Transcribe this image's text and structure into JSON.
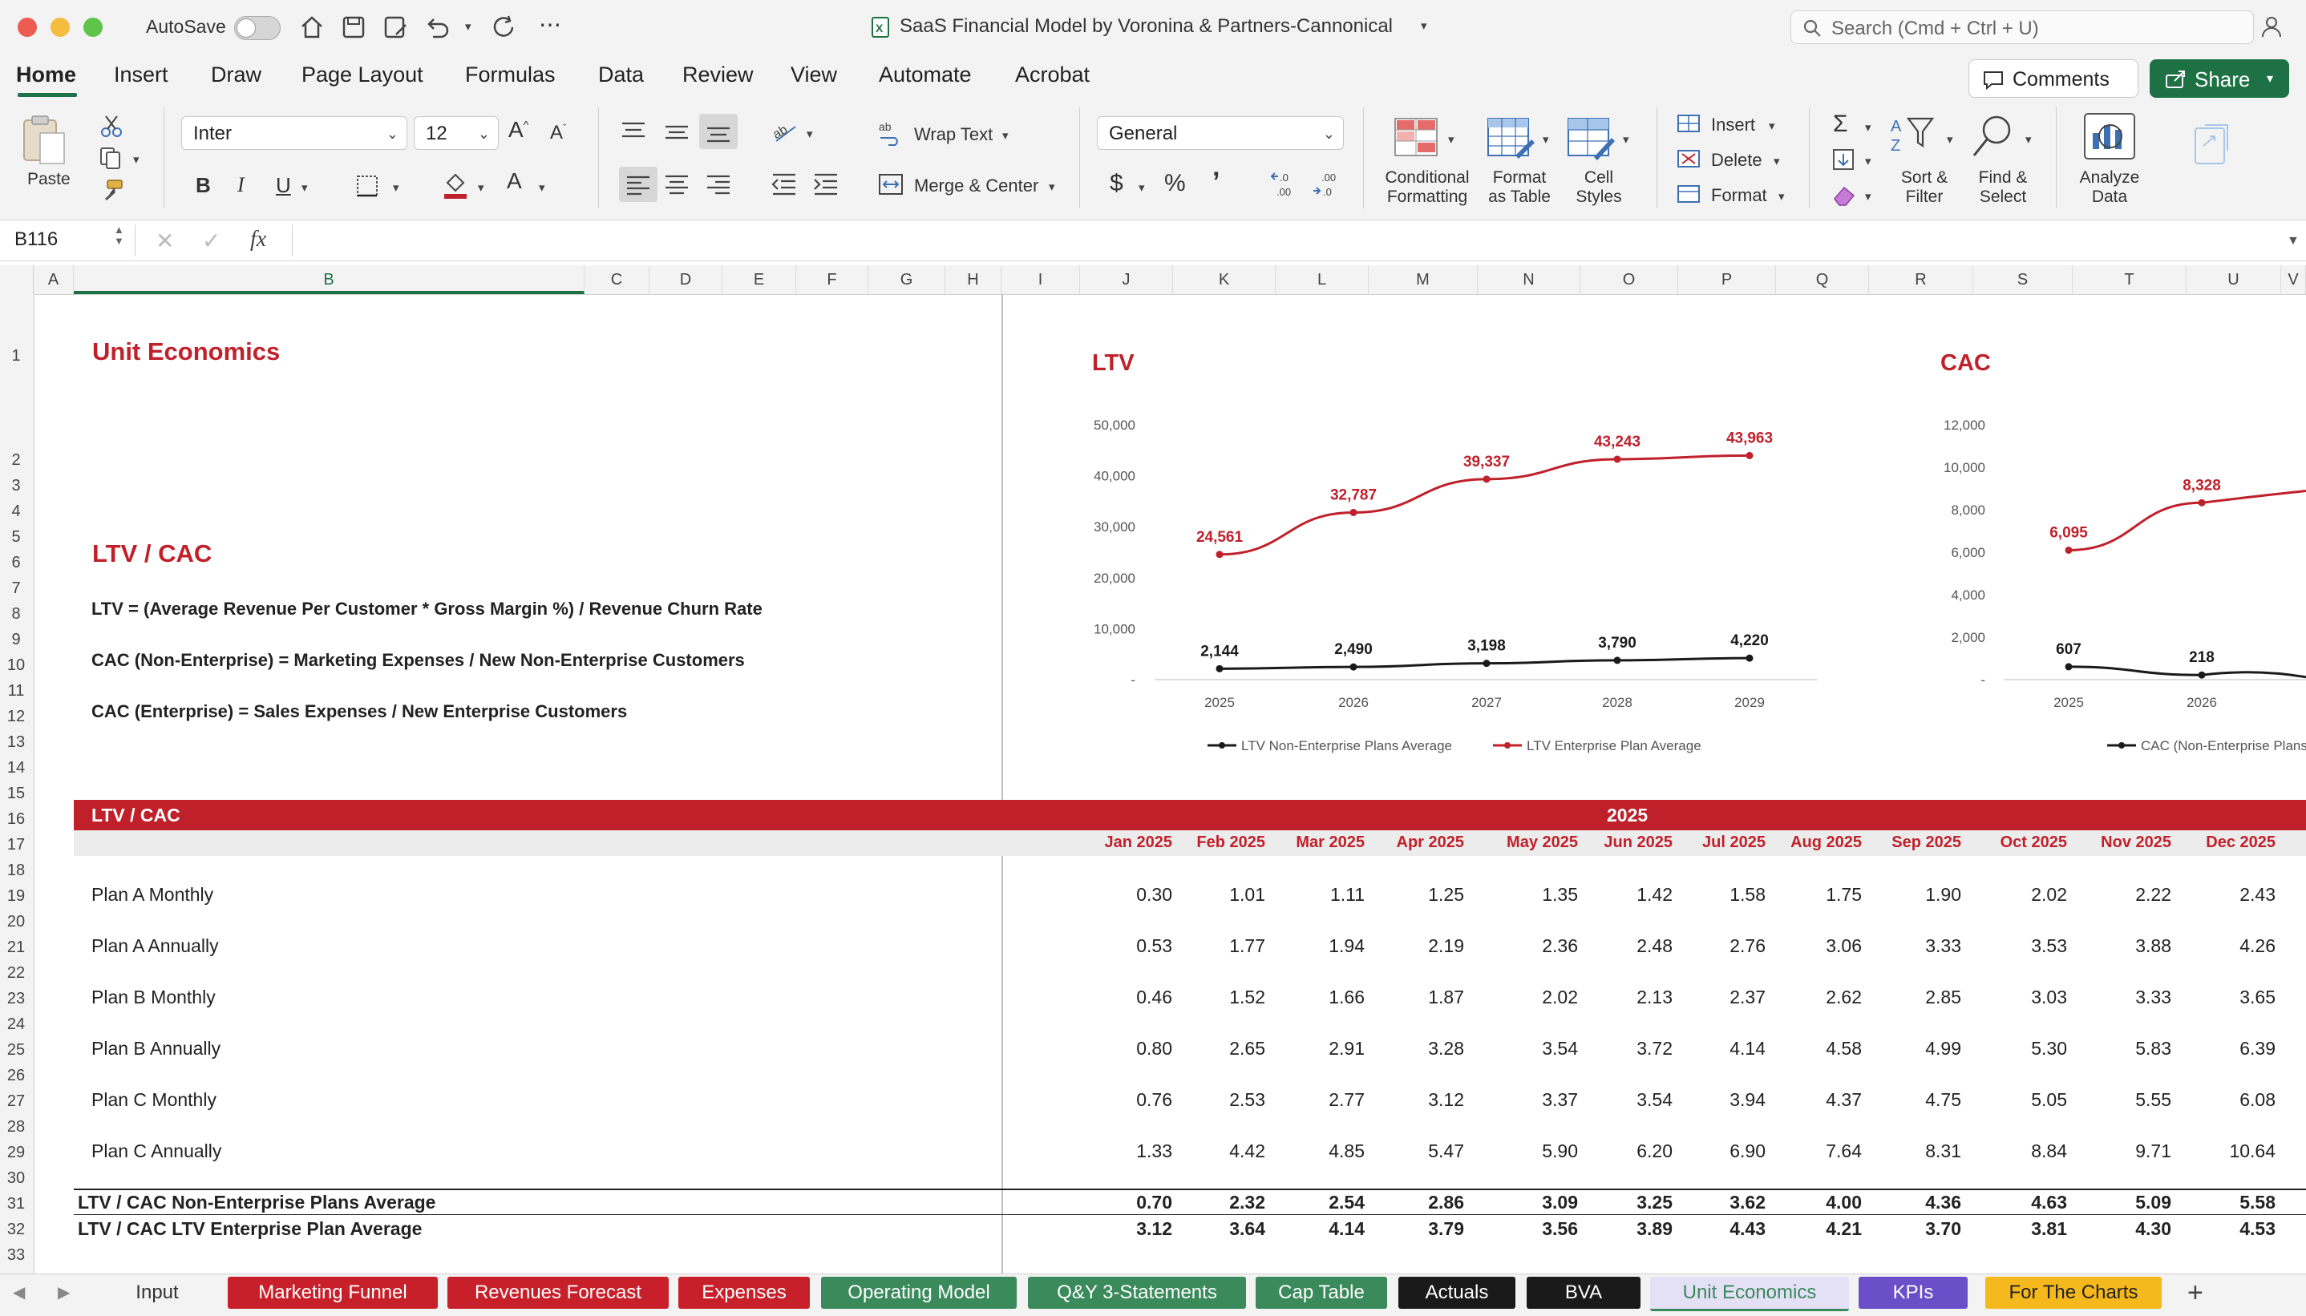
{
  "window": {
    "autosave_label": "AutoSave",
    "title": "SaaS Financial Model by Voronina & Partners-Cannonical",
    "search_placeholder": "Search (Cmd + Ctrl + U)"
  },
  "ribbon_tabs": [
    "Home",
    "Insert",
    "Draw",
    "Page Layout",
    "Formulas",
    "Data",
    "Review",
    "View",
    "Automate",
    "Acrobat"
  ],
  "buttons": {
    "comments": "Comments",
    "share": "Share"
  },
  "ribbon": {
    "paste": "Paste",
    "font_name": "Inter",
    "font_size": "12",
    "wrap_text": "Wrap Text",
    "merge_center": "Merge & Center",
    "number_format": "General",
    "conditional_formatting": [
      "Conditional",
      "Formatting"
    ],
    "format_as_table": [
      "Format",
      "as Table"
    ],
    "cell_styles": [
      "Cell",
      "Styles"
    ],
    "insert": "Insert",
    "delete": "Delete",
    "format": "Format",
    "sort_filter": [
      "Sort &",
      "Filter"
    ],
    "find_select": [
      "Find &",
      "Select"
    ],
    "analyze_data": [
      "Analyze",
      "Data"
    ]
  },
  "formula_bar": {
    "cell_ref": "B116",
    "fx": "fx",
    "value": ""
  },
  "columns": [
    "A",
    "B",
    "C",
    "D",
    "E",
    "F",
    "G",
    "H",
    "I",
    "J",
    "K",
    "L",
    "M",
    "N",
    "O",
    "P",
    "Q",
    "R",
    "S",
    "T",
    "U",
    "V"
  ],
  "rows": [
    "1",
    "2",
    "3",
    "4",
    "5",
    "6",
    "7",
    "8",
    "9",
    "10",
    "11",
    "12",
    "13",
    "14",
    "15",
    "16",
    "17",
    "18",
    "19",
    "20",
    "21",
    "22",
    "23",
    "24",
    "25",
    "26",
    "27",
    "28",
    "29",
    "30",
    "31",
    "32",
    "33"
  ],
  "sheet": {
    "title": "Unit Economics",
    "subtitle": "LTV / CAC",
    "formulas": [
      "LTV = (Average Revenue Per Customer * Gross Margin %) / Revenue Churn Rate",
      "CAC (Non-Enterprise) = Marketing Expenses / New Non-Enterprise Customers",
      "CAC (Enterprise) = Sales Expenses / New Enterprise Customers"
    ],
    "table": {
      "header_label": "LTV / CAC",
      "year": "2025",
      "months": [
        "Jan 2025",
        "Feb 2025",
        "Mar 2025",
        "Apr 2025",
        "May 2025",
        "Jun 2025",
        "Jul 2025",
        "Aug 2025",
        "Sep 2025",
        "Oct 2025",
        "Nov 2025",
        "Dec 2025"
      ],
      "rows": [
        {
          "label": "Plan A Monthly",
          "values": [
            "0.30",
            "1.01",
            "1.11",
            "1.25",
            "1.35",
            "1.42",
            "1.58",
            "1.75",
            "1.90",
            "2.02",
            "2.22",
            "2.43"
          ]
        },
        {
          "label": "Plan A Annually",
          "values": [
            "0.53",
            "1.77",
            "1.94",
            "2.19",
            "2.36",
            "2.48",
            "2.76",
            "3.06",
            "3.33",
            "3.53",
            "3.88",
            "4.26"
          ]
        },
        {
          "label": "Plan B Monthly",
          "values": [
            "0.46",
            "1.52",
            "1.66",
            "1.87",
            "2.02",
            "2.13",
            "2.37",
            "2.62",
            "2.85",
            "3.03",
            "3.33",
            "3.65"
          ]
        },
        {
          "label": "Plan B Annually",
          "values": [
            "0.80",
            "2.65",
            "2.91",
            "3.28",
            "3.54",
            "3.72",
            "4.14",
            "4.58",
            "4.99",
            "5.30",
            "5.83",
            "6.39"
          ]
        },
        {
          "label": "Plan C Monthly",
          "values": [
            "0.76",
            "2.53",
            "2.77",
            "3.12",
            "3.37",
            "3.54",
            "3.94",
            "4.37",
            "4.75",
            "5.05",
            "5.55",
            "6.08"
          ]
        },
        {
          "label": "Plan C Annually",
          "values": [
            "1.33",
            "4.42",
            "4.85",
            "5.47",
            "5.90",
            "6.20",
            "6.90",
            "7.64",
            "8.31",
            "8.84",
            "9.71",
            "10.64"
          ]
        }
      ],
      "totals": [
        {
          "label": "LTV / CAC Non-Enterprise Plans Average",
          "values": [
            "0.70",
            "2.32",
            "2.54",
            "2.86",
            "3.09",
            "3.25",
            "3.62",
            "4.00",
            "4.36",
            "4.63",
            "5.09",
            "5.58"
          ]
        },
        {
          "label": "LTV / CAC LTV Enterprise Plan Average",
          "values": [
            "3.12",
            "3.64",
            "4.14",
            "3.79",
            "3.56",
            "3.89",
            "4.43",
            "4.21",
            "3.70",
            "3.81",
            "4.30",
            "4.53"
          ]
        }
      ]
    }
  },
  "chart_data": [
    {
      "type": "line",
      "title": "LTV",
      "categories": [
        "2025",
        "2026",
        "2027",
        "2028",
        "2029"
      ],
      "ylim": [
        0,
        50000
      ],
      "yticks": [
        "50,000",
        "40,000",
        "30,000",
        "20,000",
        "10,000",
        "-"
      ],
      "series": [
        {
          "name": "LTV Non-Enterprise Plans Average",
          "color": "#1a1a1a",
          "values": [
            2144,
            2490,
            3198,
            3790,
            4220
          ],
          "labels": [
            "2,144",
            "2,490",
            "3,198",
            "3,790",
            "4,220"
          ]
        },
        {
          "name": "LTV Enterprise Plan Average",
          "color": "#c0202a",
          "values": [
            24561,
            32787,
            39337,
            43243,
            43963
          ],
          "labels": [
            "24,561",
            "32,787",
            "39,337",
            "43,243",
            "43,963"
          ]
        }
      ],
      "legend": "bottom",
      "grid": false
    },
    {
      "type": "line",
      "title": "CAC",
      "categories": [
        "2025",
        "2026"
      ],
      "ylim": [
        0,
        12000
      ],
      "yticks": [
        "12,000",
        "10,000",
        "8,000",
        "6,000",
        "4,000",
        "2,000",
        "-"
      ],
      "series": [
        {
          "name": "CAC (Non-Enterprise Plans",
          "color": "#1a1a1a",
          "values": [
            607,
            218
          ],
          "labels": [
            "607",
            "218"
          ]
        },
        {
          "name": "",
          "color": "#c0202a",
          "values": [
            6095,
            8328
          ],
          "labels": [
            "6,095",
            "8,328"
          ]
        }
      ],
      "legend": "bottom",
      "grid": false
    }
  ],
  "sheet_tabs": [
    {
      "label": "Input",
      "color": "#f3f3f3",
      "text": "#333333"
    },
    {
      "label": "Marketing Funnel",
      "color": "#c8202a",
      "text": "#ffffff"
    },
    {
      "label": "Revenues Forecast",
      "color": "#c8202a",
      "text": "#ffffff"
    },
    {
      "label": "Expenses",
      "color": "#c8202a",
      "text": "#ffffff"
    },
    {
      "label": "Operating Model",
      "color": "#3a8a5c",
      "text": "#ffffff"
    },
    {
      "label": "Q&Y 3-Statements",
      "color": "#3a8a5c",
      "text": "#ffffff"
    },
    {
      "label": "Cap Table",
      "color": "#3a8a5c",
      "text": "#ffffff"
    },
    {
      "label": "Actuals",
      "color": "#1a1a1a",
      "text": "#ffffff"
    },
    {
      "label": "BVA",
      "color": "#1a1a1a",
      "text": "#ffffff"
    },
    {
      "label": "Unit Economics",
      "color": "#e4e0f5",
      "text": "#3a8a5c"
    },
    {
      "label": "KPIs",
      "color": "#6a4fc8",
      "text": "#ffffff"
    },
    {
      "label": "For The Charts",
      "color": "#f5b81d",
      "text": "#222222"
    }
  ],
  "colors": {
    "accent_red": "#c0202a",
    "excel_green": "#1e7145"
  }
}
